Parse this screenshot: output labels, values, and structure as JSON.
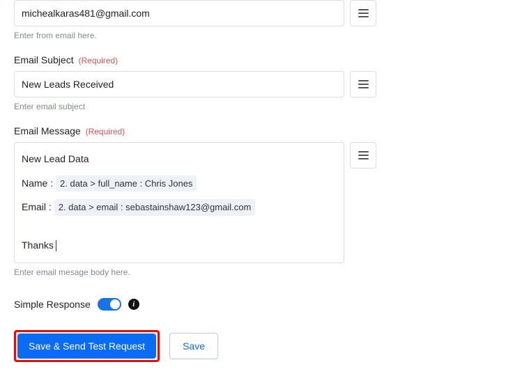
{
  "from_email": {
    "value": "michealkaras481@gmail.com",
    "helper": "Enter from email here."
  },
  "subject": {
    "label": "Email Subject",
    "required": "(Required)",
    "value": "New Leads Received",
    "helper": "Enter email subject"
  },
  "message": {
    "label": "Email Message",
    "required": "(Required)",
    "line1": "New Lead Data",
    "name_label": "Name :",
    "name_token": "2. data > full_name : Chris Jones",
    "email_label": "Email :",
    "email_token": "2. data > email : sebastainshaw123@gmail.com",
    "thanks": "Thanks",
    "helper": "Enter email mesage body here."
  },
  "simple_response": {
    "label": "Simple Response"
  },
  "buttons": {
    "save_send": "Save & Send Test Request",
    "save": "Save"
  }
}
